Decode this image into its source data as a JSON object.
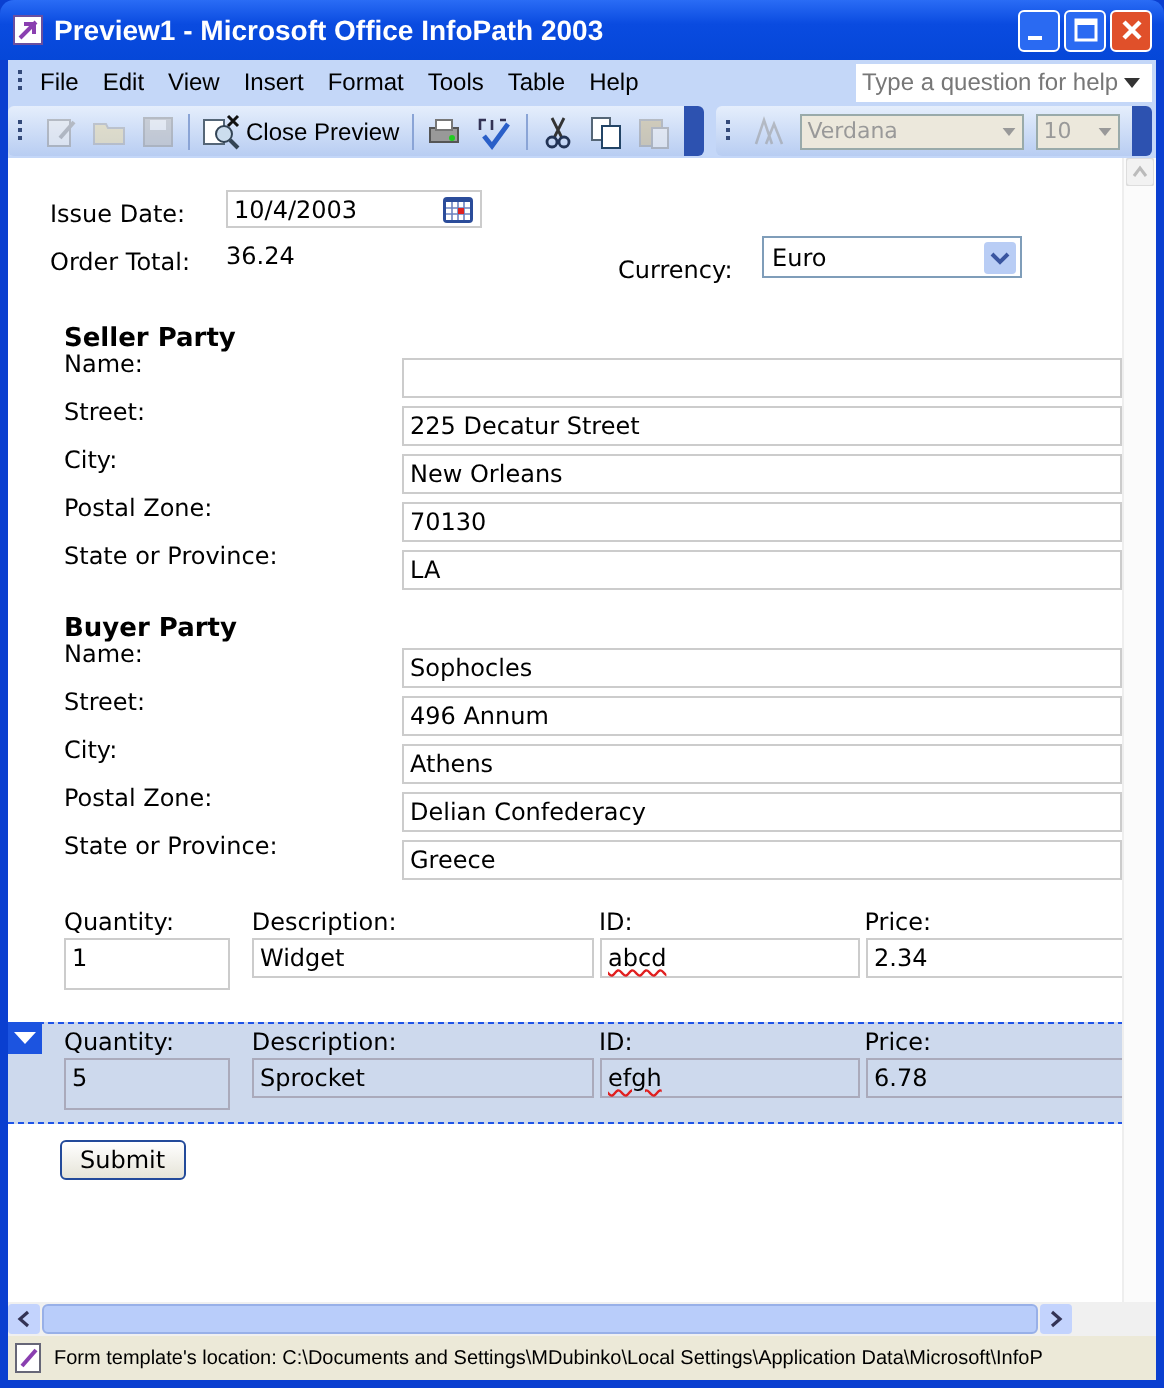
{
  "window": {
    "title": "Preview1 - Microsoft Office InfoPath 2003"
  },
  "menu": [
    "File",
    "Edit",
    "View",
    "Insert",
    "Format",
    "Tools",
    "Table",
    "Help"
  ],
  "help_box": {
    "placeholder": "Type a question for help"
  },
  "toolbar": {
    "close_preview": "Close Preview",
    "font": "Verdana",
    "size": "10",
    "disabled_font": true
  },
  "header": {
    "issue_date_label": "Issue Date:",
    "issue_date": "10/4/2003",
    "order_total_label": "Order Total:",
    "order_total": "36.24",
    "currency_label": "Currency:",
    "currency": "Euro"
  },
  "parties": [
    {
      "title": "Seller Party",
      "fields": [
        {
          "label": "Name:"
        },
        {
          "label": "Street:",
          "value": "225 Decatur Street"
        },
        {
          "label": "City:",
          "value": "New Orleans"
        },
        {
          "label": "Postal Zone:",
          "value": "70130"
        },
        {
          "label": "State or Province:",
          "value": "LA"
        }
      ]
    },
    {
      "title": "Buyer Party",
      "fields": [
        {
          "label": "Name:",
          "value": "Sophocles"
        },
        {
          "label": "Street:",
          "value": "496 Annum"
        },
        {
          "label": "City:",
          "value": "Athens"
        },
        {
          "label": "Postal Zone:",
          "value": "Delian Confederacy"
        },
        {
          "label": "State or Province:",
          "value": "Greece"
        }
      ]
    }
  ],
  "line_items": [
    {
      "selected": false,
      "quantity_label": "Quantity:",
      "quantity": "1",
      "description_label": "Description:",
      "description": "Widget",
      "id_label": "ID:",
      "id": "abcd",
      "price_label": "Price:",
      "price": "2.34"
    },
    {
      "selected": true,
      "quantity_label": "Quantity:",
      "quantity": "5",
      "description_label": "Description:",
      "description": "Sprocket",
      "id_label": "ID:",
      "id": "efgh",
      "price_label": "Price:",
      "price": "6.78"
    }
  ],
  "submit": "Submit",
  "status_bar": "Form template's location: C:\\Documents and Settings\\MDubinko\\Local Settings\\Application Data\\Microsoft\\InfoP"
}
